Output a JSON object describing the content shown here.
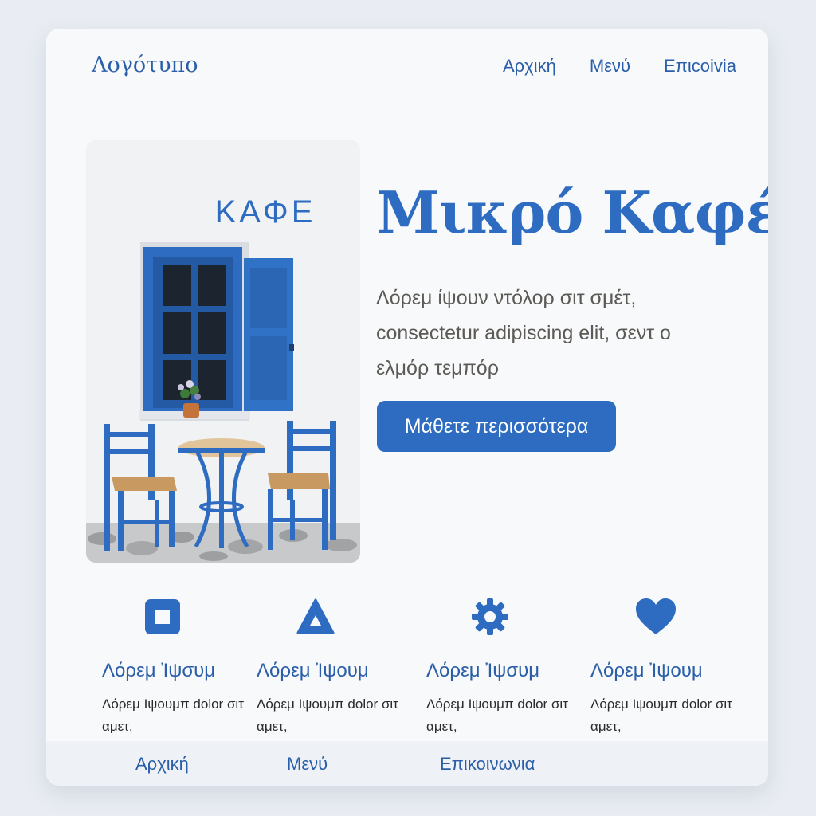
{
  "header": {
    "logo": "Λογότυπο",
    "nav": [
      "Αρχική",
      "Μενύ",
      "Επιcοivia"
    ]
  },
  "hero": {
    "image_sign": "ΚΑΦΕ",
    "title": "Μικρό Καφέ",
    "description": "Λόρεμ ίψουν ντόλορ σιτ σμέτ, consectetur adipiscing elit, σεντ ο ελμόρ τεμπόρ",
    "cta_label": "Μάθετε περισσότερα"
  },
  "features": [
    {
      "icon": "square-icon",
      "title": "Λόρεμ Ἰψσυμ",
      "desc": "Λόρεμ Ιψουμπ dolor σιτ αμετ,"
    },
    {
      "icon": "triangle-icon",
      "title": "Λόρεμ Ἰψουμ",
      "desc": "Λόρεμ Ιψουμπ dolor σιτ αμετ,"
    },
    {
      "icon": "gear-icon",
      "title": "Λόρεμ Ἰψσυμ",
      "desc": "Λόρεμ Ιψουμπ dolor σιτ αμετ,"
    },
    {
      "icon": "heart-icon",
      "title": "Λόρεμ Ἰψουμ",
      "desc": "Λόρεμ Ιψουμπ dolor σιτ αμετ,"
    }
  ],
  "footer": {
    "nav": [
      "Αρχική",
      "Μενύ",
      "Επικοινωνια"
    ]
  },
  "colors": {
    "accent": "#2d6cc0",
    "text_muted": "#5c5a55",
    "background": "#f8f9fb"
  }
}
